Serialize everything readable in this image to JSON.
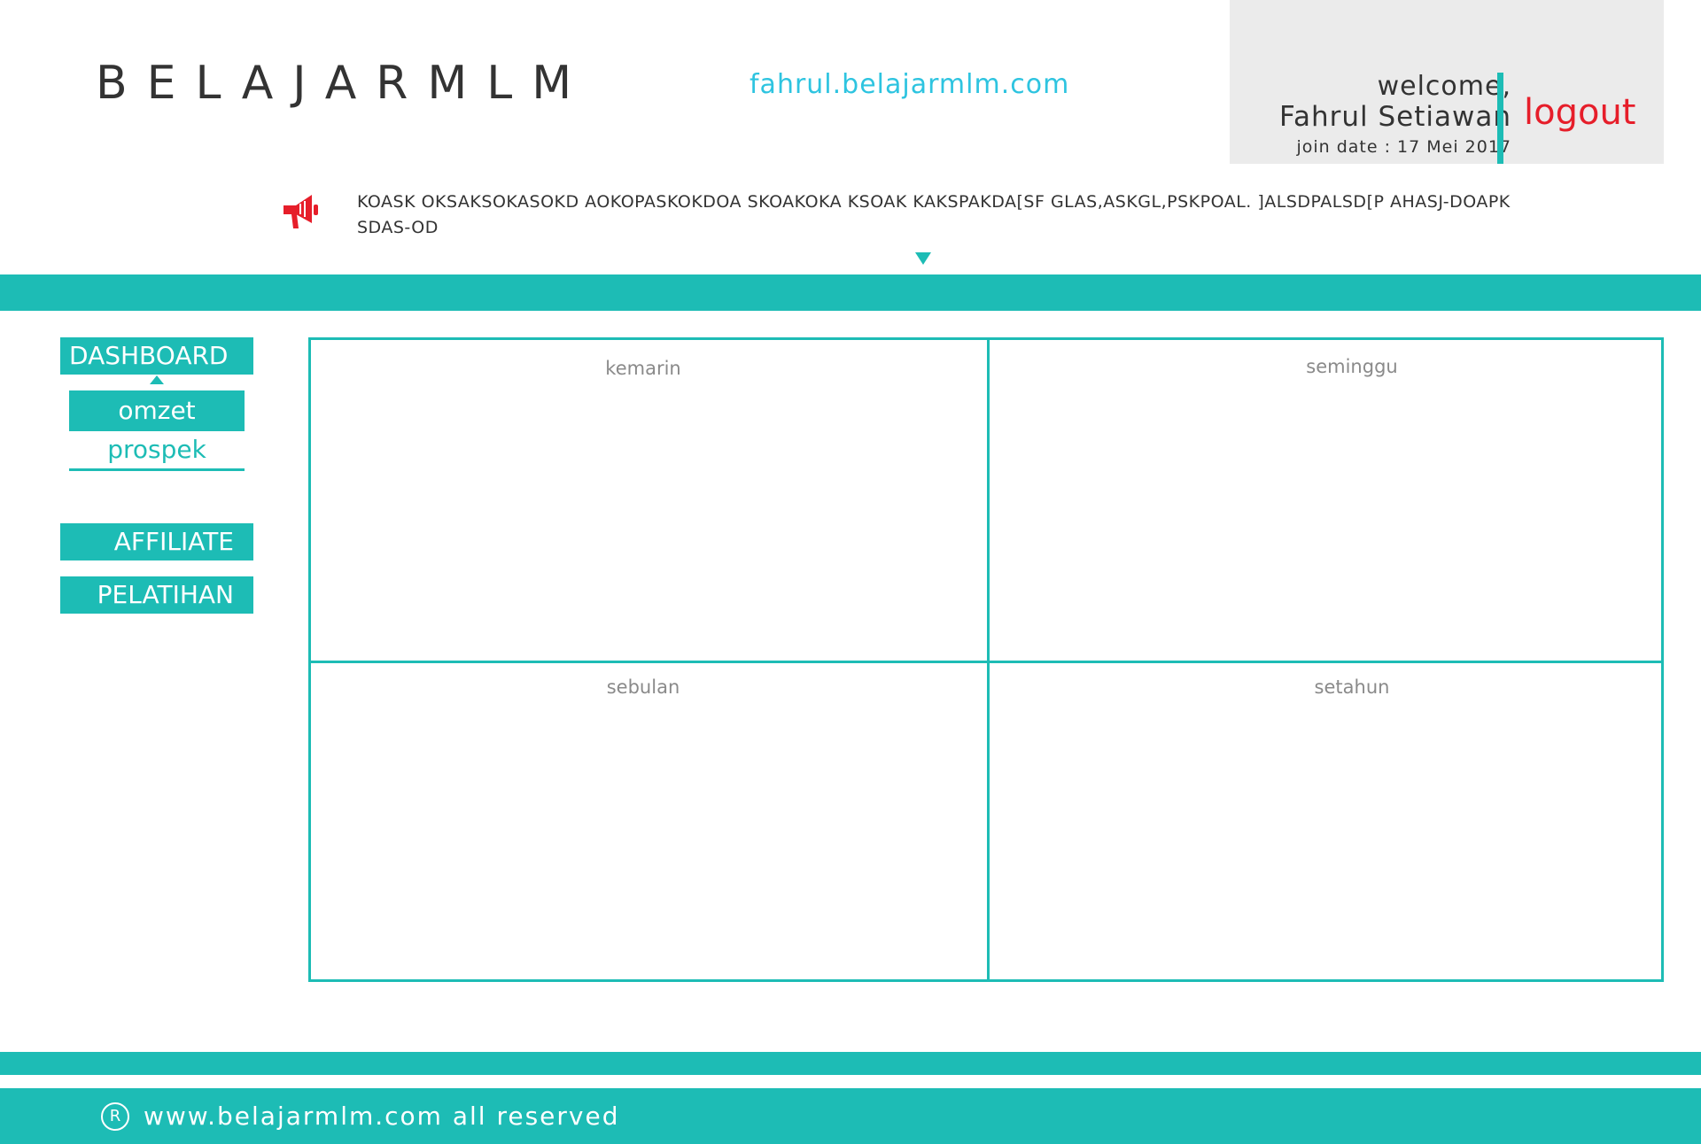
{
  "header": {
    "logo": "BELAJARMLM",
    "site_url": "fahrul.belajarmlm.com"
  },
  "user": {
    "welcome": "welcome,",
    "name": "Fahrul Setiawan",
    "join_date": "join date :  17 Mei 2017",
    "logout_label": "logout"
  },
  "announcement": {
    "icon": "megaphone-icon",
    "text": "KOASK OKSAKSOKASOKD AOKOPASKOKDOA SKOAKOKA KSOAK KAKSPAKDA[SF GLAS,ASKGL,PSKPOAL. ]ALSDPALSD[P AHASJ-DOAPK SDAS-OD"
  },
  "sidebar": {
    "dashboard": "DASHBOARD",
    "sub_items": [
      "omzet",
      "prospek"
    ],
    "affiliate": "AFFILIATE",
    "pelatihan": "PELATIHAN"
  },
  "grid": {
    "cells": [
      "kemarin",
      "seminggu",
      "sebulan",
      "setahun"
    ]
  },
  "footer": {
    "reg_symbol": "R",
    "text": "www.belajarmlm.com all reserved"
  },
  "colors": {
    "accent": "#1dbcb5",
    "link": "#2ec4e0",
    "logout": "#e61e2a",
    "panel_bg": "#ebebeb"
  }
}
